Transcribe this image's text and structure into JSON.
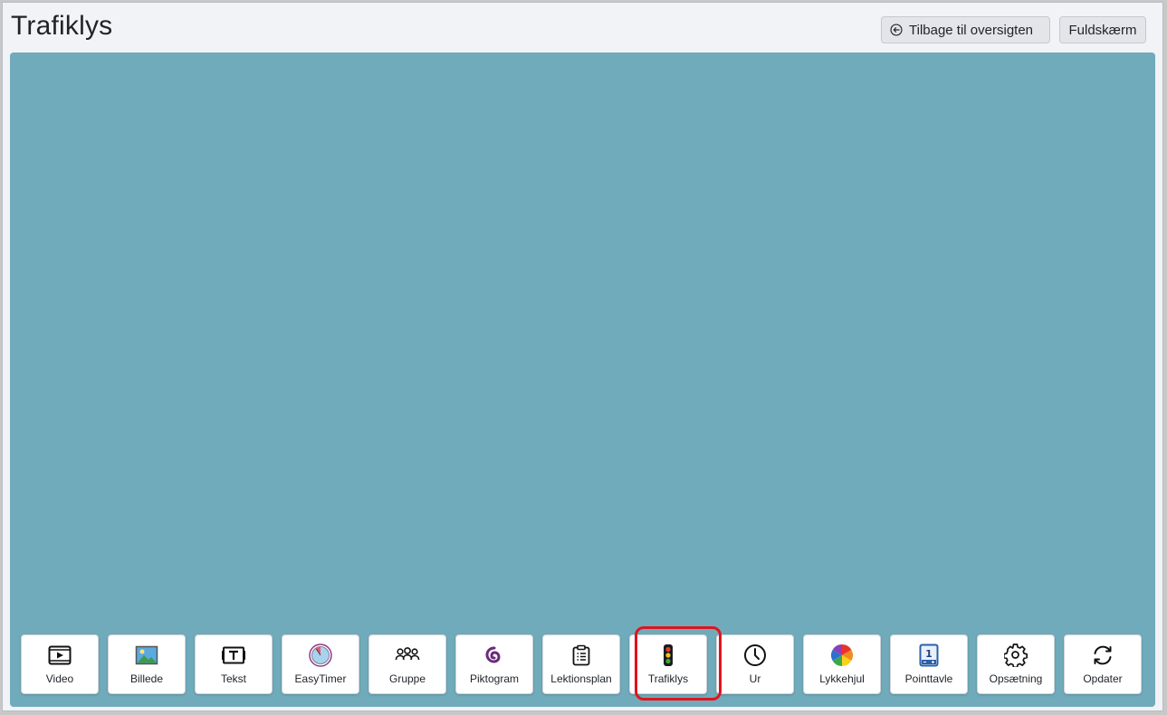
{
  "header": {
    "title": "Trafiklys",
    "back_label": "Tilbage til oversigten",
    "fullscreen_label": "Fuldskærm"
  },
  "stage": {
    "background": "#70abbb"
  },
  "toolbar": {
    "items": [
      {
        "label": "Video",
        "icon": "video-icon"
      },
      {
        "label": "Billede",
        "icon": "image-icon"
      },
      {
        "label": "Tekst",
        "icon": "text-icon"
      },
      {
        "label": "EasyTimer",
        "icon": "timer-icon"
      },
      {
        "label": "Gruppe",
        "icon": "group-icon"
      },
      {
        "label": "Piktogram",
        "icon": "pictogram-icon"
      },
      {
        "label": "Lektionsplan",
        "icon": "clipboard-icon"
      },
      {
        "label": "Trafiklys",
        "icon": "traffic-light-icon",
        "selected": true
      },
      {
        "label": "Ur",
        "icon": "clock-icon"
      },
      {
        "label": "Lykkehjul",
        "icon": "color-wheel-icon"
      },
      {
        "label": "Pointtavle",
        "icon": "scoreboard-icon"
      },
      {
        "label": "Opsætning",
        "icon": "gear-icon"
      },
      {
        "label": "Opdater",
        "icon": "refresh-icon"
      }
    ],
    "highlight_color": "#e0141e"
  }
}
